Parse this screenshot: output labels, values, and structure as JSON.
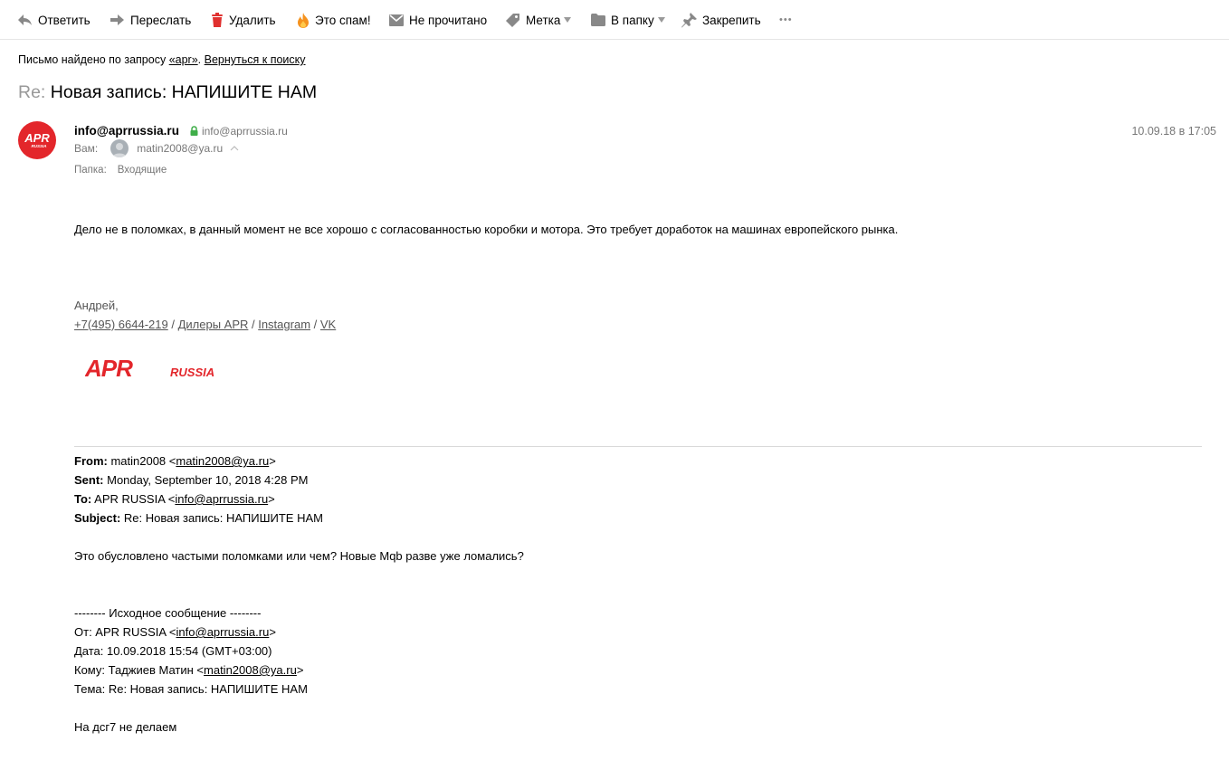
{
  "toolbar": {
    "reply": "Ответить",
    "forward": "Переслать",
    "delete": "Удалить",
    "spam": "Это спам!",
    "unread": "Не прочитано",
    "label": "Метка",
    "to_folder": "В папку",
    "pin": "Закрепить",
    "more": "•••",
    "colors": {
      "icon_gray": "#888888",
      "delete_red": "#e0302f",
      "spam_orange": "#f5921e"
    }
  },
  "search_notice": {
    "prefix": "Письмо найдено по запросу ",
    "query": "«apr»",
    "separator": ". ",
    "back_link": "Вернуться к поиску"
  },
  "subject": {
    "re": "Re:",
    "title": "Новая запись: НАПИШИТЕ НАМ"
  },
  "sender": {
    "name": "info@aprrussia.ru",
    "email": "info@aprrussia.ru",
    "avatar_text": "APR",
    "avatar_subtext": "RUSSIA",
    "avatar_color": "#e3262b"
  },
  "date": "10.09.18 в 17:05",
  "recipient": {
    "label": "Вам:",
    "email": "matin2008@ya.ru"
  },
  "folder": {
    "label": "Папка:",
    "name": "Входящие"
  },
  "body": {
    "main": "Дело не в поломках, в данный момент не все хорошо с согласованностью коробки и мотора. Это требует доработок на машинах европейского рынка.",
    "signature_name": "Андрей,",
    "phone": "+7(495) 6644-219",
    "sep": " / ",
    "dealers": "Дилеры APR",
    "instagram": "Instagram",
    "vk": "VK",
    "logo_text": "APR",
    "logo_subtext": "RUSSIA",
    "logo_color": "#e3262b"
  },
  "quoted": {
    "from_label": "From:",
    "from_name": " matin2008 <",
    "from_email": "matin2008@ya.ru",
    "close": ">",
    "sent_label": "Sent:",
    "sent_value": " Monday, September 10, 2018 4:28 PM",
    "to_label": "To:",
    "to_name": " APR RUSSIA <",
    "to_email": "info@aprrussia.ru",
    "subject_label": "Subject:",
    "subject_value": " Re: Новая запись: НАПИШИТЕ НАМ",
    "question": "Это обусловлено частыми поломками или чем? Новые Mqb разве уже ломались?",
    "orig_header": "-------- Исходное сообщение --------",
    "orig_from_prefix": "От: APR RUSSIA <",
    "orig_from_email": "info@aprrussia.ru",
    "orig_date": "Дата: 10.09.2018 15:54 (GMT+03:00)",
    "orig_to_prefix": "Кому: Таджиев Матин <",
    "orig_to_email": "matin2008@ya.ru",
    "orig_subject": "Тема: Re: Новая запись: НАПИШИТЕ НАМ",
    "orig_body": "На дсг7 не делаем"
  }
}
